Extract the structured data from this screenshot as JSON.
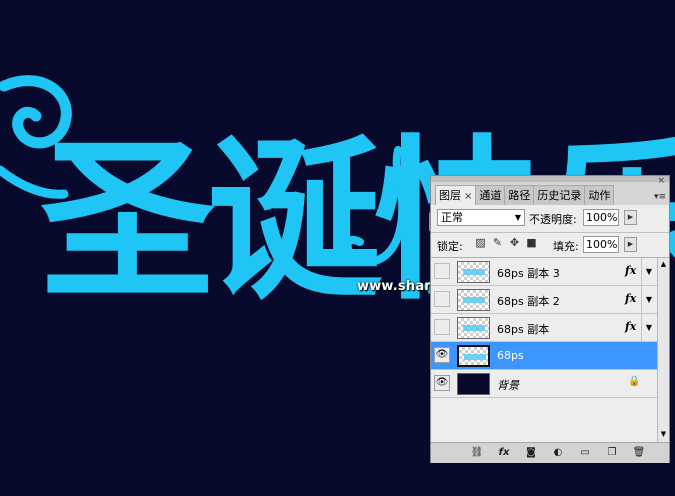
{
  "canvas": {
    "headline": "圣诞快乐",
    "text_color": "#1ec5f5",
    "background_color": "#070a2c",
    "watermark": "www.shanjia.net.cn"
  },
  "layers_panel": {
    "tabs": [
      {
        "label": "图层",
        "active": true
      },
      {
        "label": "通道",
        "active": false
      },
      {
        "label": "路径",
        "active": false
      },
      {
        "label": "历史记录",
        "active": false
      },
      {
        "label": "动作",
        "active": false
      }
    ],
    "tab_close_glyph": "×",
    "panel_close_glyph": "×",
    "menu_glyph": "▾≡",
    "blend_mode": "正常",
    "opacity_label": "不透明度:",
    "opacity_value": "100%",
    "lock_label": "锁定:",
    "lock_icons": [
      "lock-transparent-icon",
      "lock-paint-icon",
      "lock-move-icon",
      "lock-all-icon"
    ],
    "fill_label": "填充:",
    "fill_value": "100%",
    "layers": [
      {
        "name": "68ps 副本 3",
        "visible": false,
        "fx": "fx",
        "selected": false
      },
      {
        "name": "68ps 副本 2",
        "visible": false,
        "fx": "fx",
        "selected": false
      },
      {
        "name": "68ps  副本",
        "visible": false,
        "fx": "fx",
        "selected": false
      },
      {
        "name": "68ps",
        "visible": true,
        "fx": "",
        "selected": true
      },
      {
        "name": "背景",
        "visible": true,
        "fx": "",
        "selected": false,
        "locked": true
      }
    ],
    "bottom_icons": [
      "link-icon",
      "fx-icon",
      "mask-icon",
      "adjustment-icon",
      "folder-icon",
      "new-layer-icon",
      "trash-icon"
    ],
    "selected_color": "#3d95ff"
  }
}
